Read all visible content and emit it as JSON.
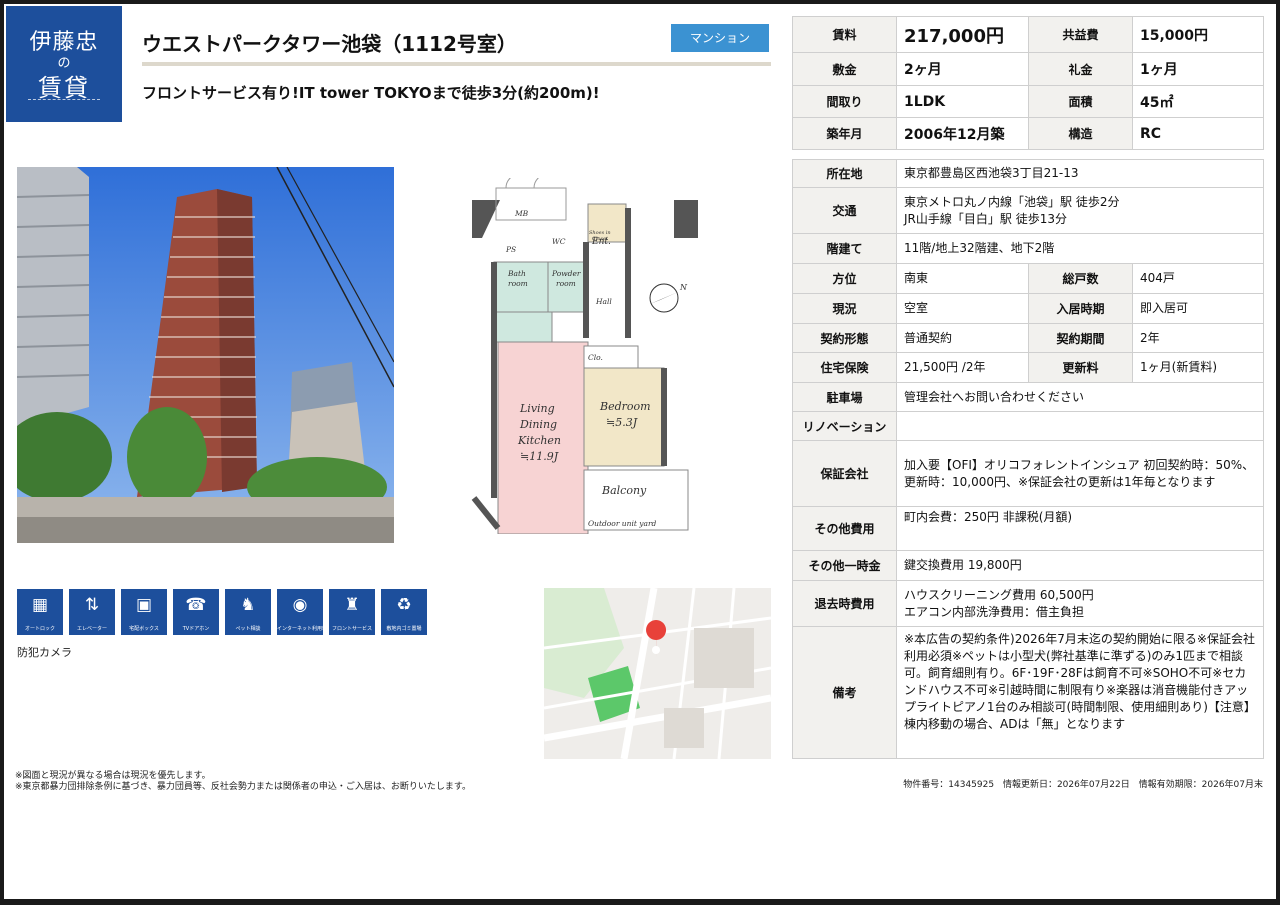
{
  "brand": {
    "line1": "伊藤忠",
    "line2": "の",
    "line3": "賃貸"
  },
  "header": {
    "title": "ウエストパークタワー池袋（1112号室）",
    "badge": "マンション",
    "subtitle": "フロントサービス有り!IT tower TOKYOまで徒歩3分(約200m)!"
  },
  "floorplan": {
    "labels": {
      "mb": "MB",
      "ps": "PS",
      "wc": "WC",
      "ent": "Ent.",
      "shoes": "Shoes in",
      "closet": "Closet",
      "bath": "Bath",
      "room": "room",
      "powder": "Powder",
      "powder_room": "room",
      "hall": "Hall",
      "living": "Living",
      "dining": "Dining",
      "kitchen": "Kitchen",
      "ldk_size": "≒11.9J",
      "bedroom": "Bedroom",
      "bed_size": "≒5.3J",
      "clo": "Clo.",
      "balcony": "Balcony",
      "outdoor": "Outdoor unit yard",
      "north": "N"
    }
  },
  "amenities": [
    {
      "icon": "auto-lock-icon",
      "glyph": "▦",
      "label": "オートロック"
    },
    {
      "icon": "elevator-icon",
      "glyph": "⇅",
      "label": "エレベーター"
    },
    {
      "icon": "delivery-box-icon",
      "glyph": "▣",
      "label": "宅配ボックス"
    },
    {
      "icon": "tv-intercom-icon",
      "glyph": "☎",
      "label": "TVドアホン"
    },
    {
      "icon": "pet-icon",
      "glyph": "♞",
      "label": "ペット相談"
    },
    {
      "icon": "internet-icon",
      "glyph": "◉",
      "label": "インターネット利用料無料"
    },
    {
      "icon": "front-service-icon",
      "glyph": "♜",
      "label": "フロントサービス"
    },
    {
      "icon": "garbage-icon",
      "glyph": "♻",
      "label": "敷地内ゴミ置場"
    }
  ],
  "security_text": "防犯カメラ",
  "main_table": {
    "rent_label": "賃料",
    "rent": "217,000円",
    "common_label": "共益費",
    "common": "15,000円",
    "deposit_label": "敷金",
    "deposit": "2ヶ月",
    "key_money_label": "礼金",
    "key_money": "1ヶ月",
    "layout_label": "間取り",
    "layout": "1LDK",
    "area_label": "面積",
    "area": "45㎡",
    "built_label": "築年月",
    "built": "2006年12月築",
    "structure_label": "構造",
    "structure": "RC"
  },
  "detail_table": {
    "address_label": "所在地",
    "address": "東京都豊島区西池袋3丁目21-13",
    "access_label": "交通",
    "access1": "東京メトロ丸ノ内線「池袋」駅 徒歩2分",
    "access2": "JR山手線「目白」駅 徒歩13分",
    "floor_label": "階建て",
    "floor": "11階/地上32階建、地下2階",
    "direction_label": "方位",
    "direction": "南東",
    "units_label": "総戸数",
    "units": "404戸",
    "status_label": "現況",
    "status": "空室",
    "movein_label": "入居時期",
    "movein": "即入居可",
    "contract_label": "契約形態",
    "contract": "普通契約",
    "period_label": "契約期間",
    "period": "2年",
    "insurance_label": "住宅保険",
    "insurance": "21,500円 /2年",
    "renewal_label": "更新料",
    "renewal": "1ヶ月(新賃料)",
    "parking_label": "駐車場",
    "parking": "管理会社へお問い合わせください",
    "renovation_label": "リノベーション",
    "renovation": "",
    "guarantor_label": "保証会社",
    "guarantor": "加入要【OFI】オリコフォレントインシュア 初回契約時：50%、更新時：10,000円、※保証会社の更新は1年毎となります",
    "other_fee_label": "その他費用",
    "other_fee": "町内会費：250円 非課税(月額)",
    "onetime_label": "その他一時金",
    "onetime": "鍵交換費用 19,800円",
    "moveout_label": "退去時費用",
    "moveout1": "ハウスクリーニング費用 60,500円",
    "moveout2": "エアコン内部洗浄費用：借主負担",
    "remarks_label": "備考",
    "remarks": "※本広告の契約条件)2026年7月末迄の契約開始に限る※保証会社利用必須※ペットは小型犬(弊社基準に準ずる)のみ1匹まで相談可。飼育細則有り。6F･19F･28Fは飼育不可※SOHO不可※セカンドハウス不可※引越時間に制限有り※楽器は消音機能付きアップライトピアノ1台のみ相談可(時間制限、使用細則あり)【注意】棟内移動の場合、ADは「無」となります"
  },
  "notes": {
    "line1": "※図面と現況が異なる場合は現況を優先します。",
    "line2": "※東京都暴力団排除条例に基づき、暴力団員等、反社会勢力または関係者の申込・ご入居は、お断りいたします。"
  },
  "footer": {
    "property_id": "物件番号：14345925",
    "updated": "情報更新日：2026年07月22日",
    "valid": "情報有効期限：2026年07月末"
  },
  "colors": {
    "brand": "#1d4f9c",
    "badge": "#3b92d2",
    "header_cell": "#f2f1ee",
    "ldk_fill": "#f7d3d3",
    "bedroom_fill": "#f2e7c8",
    "wet_fill": "#cfe8df"
  }
}
